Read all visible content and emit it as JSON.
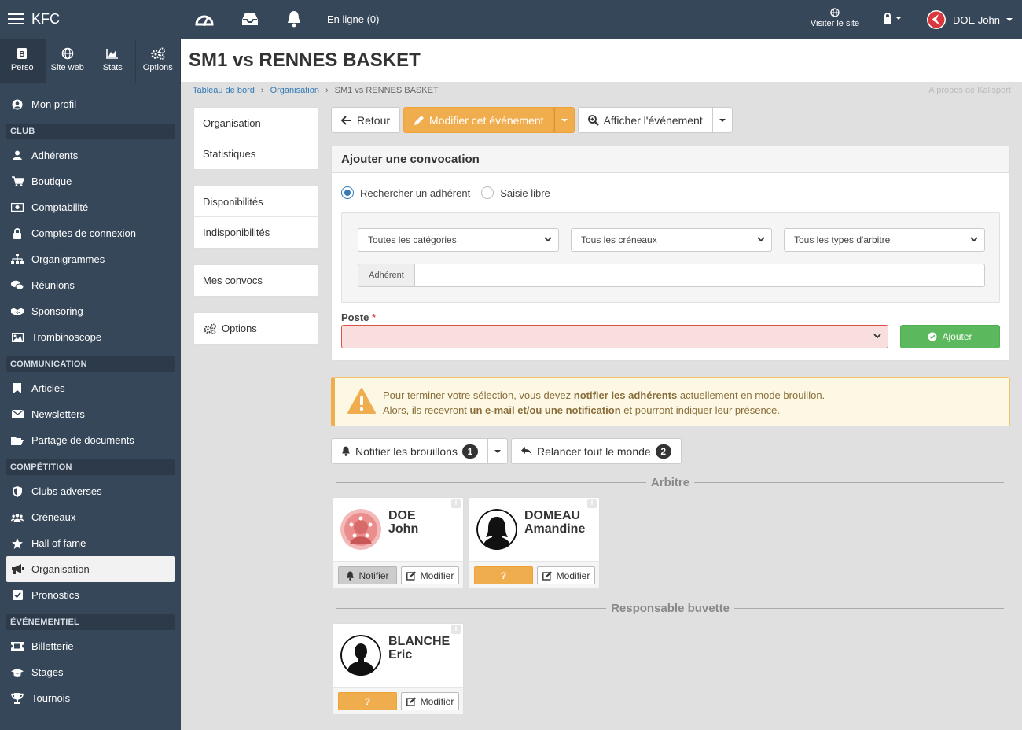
{
  "app": {
    "brand": "KFC"
  },
  "topbar": {
    "online_label": "En ligne (0)",
    "visit_label": "Visiter le site",
    "user_name": "DOE John"
  },
  "sidebar": {
    "tabs": [
      {
        "label": "Perso",
        "icon": "book-icon"
      },
      {
        "label": "Site web",
        "icon": "globe-icon"
      },
      {
        "label": "Stats",
        "icon": "chart-icon"
      },
      {
        "label": "Options",
        "icon": "gears-icon"
      }
    ],
    "profile_label": "Mon profil",
    "sections": [
      {
        "title": "CLUB",
        "items": [
          "Adhérents",
          "Boutique",
          "Comptabilité",
          "Comptes de connexion",
          "Organigrammes",
          "Réunions",
          "Sponsoring",
          "Trombinoscope"
        ]
      },
      {
        "title": "COMMUNICATION",
        "items": [
          "Articles",
          "Newsletters",
          "Partage de documents"
        ]
      },
      {
        "title": "COMPÉTITION",
        "items": [
          "Clubs adverses",
          "Créneaux",
          "Hall of fame",
          "Organisation",
          "Pronostics"
        ]
      },
      {
        "title": "ÉVÉNEMENTIEL",
        "items": [
          "Billetterie",
          "Stages",
          "Tournois"
        ]
      }
    ]
  },
  "page": {
    "title": "SM1 vs RENNES BASKET",
    "breadcrumb": [
      "Tableau de bord",
      "Organisation",
      "SM1 vs RENNES BASKET"
    ],
    "about": "A propos de Kalisport"
  },
  "left_menu": {
    "group1": [
      "Organisation",
      "Statistiques"
    ],
    "group2": [
      "Disponibilités",
      "Indisponibilités"
    ],
    "group3": [
      "Mes convocs"
    ],
    "group4": [
      "Options"
    ]
  },
  "toolbar": {
    "back": "Retour",
    "edit": "Modifier cet événement",
    "view": "Afficher l'événement"
  },
  "convocation": {
    "title": "Ajouter une convocation",
    "radio_search": "Rechercher un adhérent",
    "radio_free": "Saisie libre",
    "select_categories": "Toutes les catégories",
    "select_slots": "Tous les créneaux",
    "select_referee": "Tous les types d'arbitre",
    "member_addon": "Adhérent",
    "poste_label": "Poste",
    "poste_required": "*",
    "add_button": "Ajouter"
  },
  "alert": {
    "l1_a": "Pour terminer votre sélection, vous devez ",
    "l1_b": "notifier les adhérents",
    "l1_c": " actuellement en mode brouillon.",
    "l2_a": "Alors, ils recevront ",
    "l2_b": "un e-mail et/ou une notification",
    "l2_c": " et pourront indiquer leur présence."
  },
  "actions": {
    "notify_drafts": "Notifier les brouillons",
    "notify_count": "1",
    "remind_all": "Relancer tout le monde",
    "remind_count": "2"
  },
  "groups": [
    {
      "title": "Arbitre",
      "people": [
        {
          "last": "DOE",
          "first": "John",
          "status": "Notifier",
          "edit": "Modifier"
        },
        {
          "last": "DOMEAU",
          "first": "Amandine",
          "status": "?",
          "edit": "Modifier"
        }
      ]
    },
    {
      "title": "Responsable buvette",
      "people": [
        {
          "last": "BLANCHE",
          "first": "Eric",
          "status": "?",
          "edit": "Modifier"
        }
      ]
    }
  ],
  "colors": {
    "sidebar": "#37475a",
    "orange": "#f0ad4e",
    "green": "#5cb85c",
    "danger": "#d9534f",
    "link": "#337ab7"
  }
}
